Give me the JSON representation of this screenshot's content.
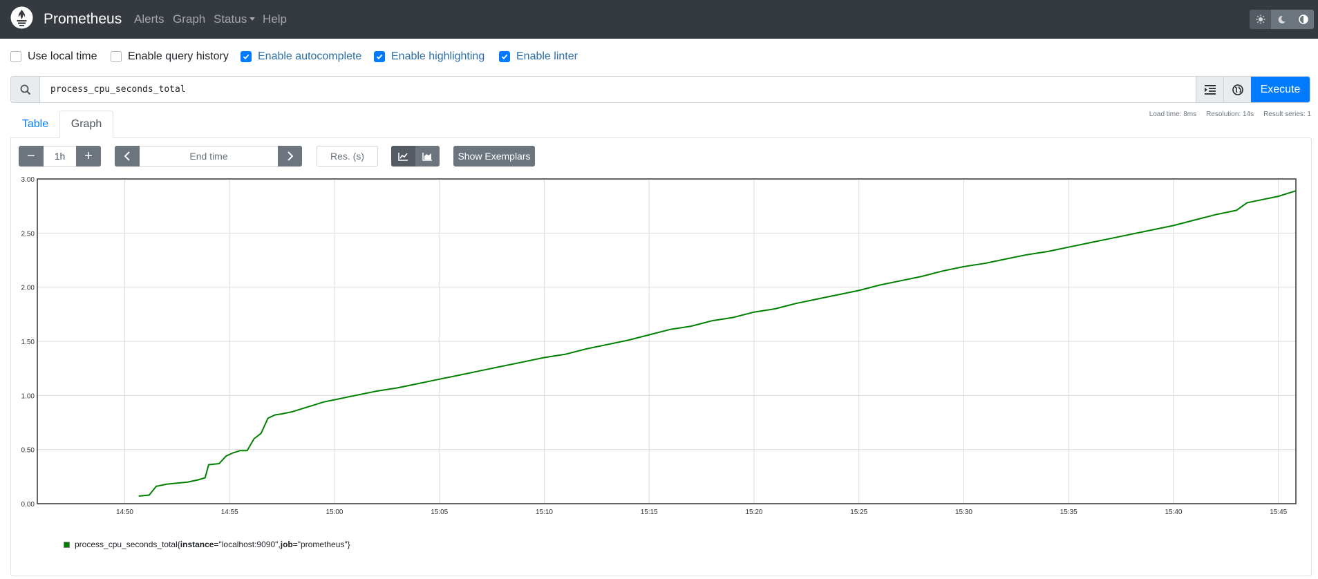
{
  "navbar": {
    "brand": "Prometheus",
    "items": [
      {
        "label": "Alerts"
      },
      {
        "label": "Graph"
      },
      {
        "label": "Status"
      },
      {
        "label": "Help"
      }
    ],
    "theme_buttons": [
      "light-theme-icon",
      "dark-theme-icon",
      "auto-theme-icon"
    ]
  },
  "options": [
    {
      "label": "Use local time",
      "checked": false
    },
    {
      "label": "Enable query history",
      "checked": false
    },
    {
      "label": "Enable autocomplete",
      "checked": true
    },
    {
      "label": "Enable highlighting",
      "checked": true
    },
    {
      "label": "Enable linter",
      "checked": true
    }
  ],
  "query": {
    "value": "process_cpu_seconds_total",
    "execute_label": "Execute"
  },
  "stats": {
    "load_time": "Load time: 8ms",
    "resolution": "Resolution: 14s",
    "result_series": "Result series: 1"
  },
  "tabs": {
    "table": "Table",
    "graph": "Graph"
  },
  "controls": {
    "range": "1h",
    "minus": "−",
    "plus": "+",
    "end_time_placeholder": "End time",
    "prev": "‹",
    "next": "›",
    "resolution_placeholder": "Res. (s)",
    "show_exemplars": "Show Exemplars"
  },
  "colors": {
    "navbar": "#343a40",
    "primary": "#007bff",
    "series": "#008000"
  },
  "legend": {
    "metric": "process_cpu_seconds_total",
    "open_brace": "{",
    "label1_key": "instance",
    "label1_value": "=\"localhost:9090\", ",
    "label2_key": "job",
    "label2_value": "=\"prometheus\"",
    "close_brace": "}"
  },
  "chart_data": {
    "type": "line",
    "y_ticks": [
      "0.00",
      "0.50",
      "1.00",
      "1.50",
      "2.00",
      "2.50",
      "3.00"
    ],
    "x_ticks": [
      "14:50",
      "14:55",
      "15:00",
      "15:05",
      "15:10",
      "15:15",
      "15:20",
      "15:25",
      "15:30",
      "15:35",
      "15:40",
      "15:45"
    ],
    "x_range_minutes": [
      "14:45:50",
      "15:45:50"
    ],
    "ylim": [
      0,
      3
    ],
    "grid": true,
    "series": [
      {
        "name": "process_cpu_seconds_total{instance=\"localhost:9090\", job=\"prometheus\"}",
        "x": [
          "14:50:40",
          "14:51:10",
          "14:51:30",
          "14:52:00",
          "14:52:30",
          "14:53:00",
          "14:53:30",
          "14:53:50",
          "14:54:00",
          "14:54:30",
          "14:54:50",
          "14:55:10",
          "14:55:30",
          "14:55:50",
          "14:56:10",
          "14:56:30",
          "14:56:50",
          "14:57:10",
          "14:57:30",
          "14:58:00",
          "14:58:30",
          "14:59:00",
          "14:59:30",
          "15:00:00",
          "15:01:00",
          "15:02:00",
          "15:03:00",
          "15:04:00",
          "15:05:00",
          "15:06:00",
          "15:07:00",
          "15:08:00",
          "15:09:00",
          "15:10:00",
          "15:11:00",
          "15:12:00",
          "15:13:00",
          "15:14:00",
          "15:15:00",
          "15:16:00",
          "15:17:00",
          "15:18:00",
          "15:19:00",
          "15:20:00",
          "15:21:00",
          "15:22:00",
          "15:23:00",
          "15:24:00",
          "15:25:00",
          "15:26:00",
          "15:27:00",
          "15:28:00",
          "15:29:00",
          "15:30:00",
          "15:31:00",
          "15:32:00",
          "15:33:00",
          "15:34:00",
          "15:35:00",
          "15:36:00",
          "15:37:00",
          "15:38:00",
          "15:39:00",
          "15:40:00",
          "15:41:00",
          "15:42:00",
          "15:43:00",
          "15:43:30",
          "15:44:00",
          "15:45:00",
          "15:45:50"
        ],
        "values": [
          0.07,
          0.08,
          0.16,
          0.18,
          0.19,
          0.2,
          0.22,
          0.24,
          0.36,
          0.37,
          0.44,
          0.47,
          0.49,
          0.49,
          0.6,
          0.65,
          0.79,
          0.82,
          0.83,
          0.85,
          0.88,
          0.91,
          0.94,
          0.96,
          1.0,
          1.04,
          1.07,
          1.11,
          1.15,
          1.19,
          1.23,
          1.27,
          1.31,
          1.35,
          1.38,
          1.43,
          1.47,
          1.51,
          1.56,
          1.61,
          1.64,
          1.69,
          1.72,
          1.77,
          1.8,
          1.85,
          1.89,
          1.93,
          1.97,
          2.02,
          2.06,
          2.1,
          2.15,
          2.19,
          2.22,
          2.26,
          2.3,
          2.33,
          2.37,
          2.41,
          2.45,
          2.49,
          2.53,
          2.57,
          2.62,
          2.67,
          2.71,
          2.78,
          2.8,
          2.84,
          2.89
        ]
      }
    ]
  }
}
